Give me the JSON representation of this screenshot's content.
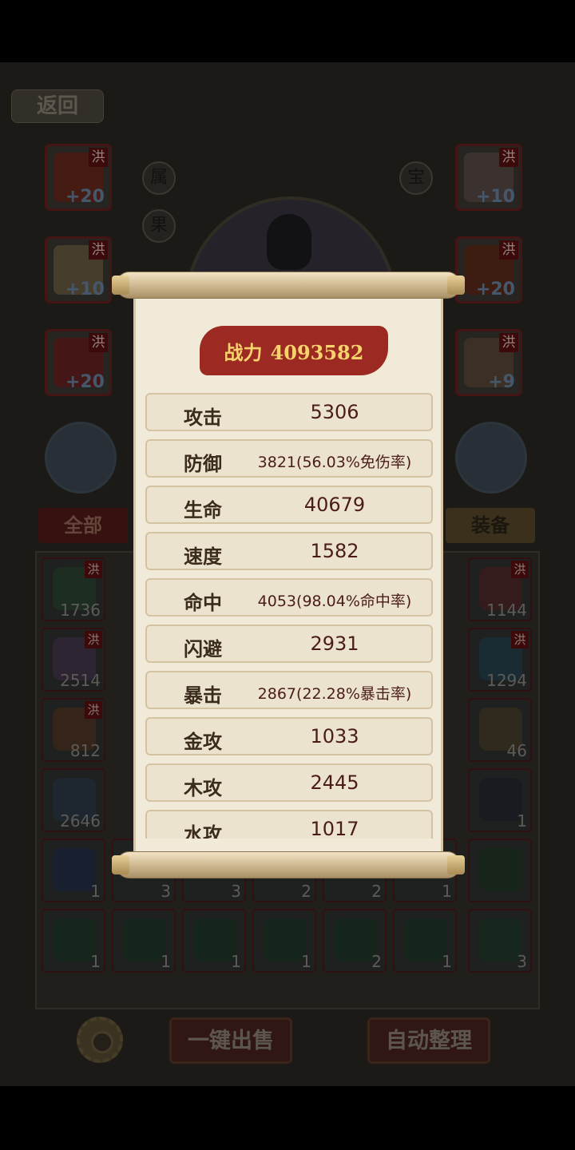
{
  "header": {
    "back_label": "返回"
  },
  "side_buttons": {
    "attr": "属",
    "fruit": "果",
    "treasure": "宝"
  },
  "equipment_left": [
    {
      "name": "weapon",
      "tag": "洪",
      "level": "+20",
      "color": "#6b2a1e"
    },
    {
      "name": "scroll",
      "tag": "洪",
      "level": "+10",
      "color": "#6c5f45"
    },
    {
      "name": "orb",
      "tag": "洪",
      "level": "+20",
      "color": "#6b2323"
    }
  ],
  "equipment_right": [
    {
      "name": "armor",
      "tag": "洪",
      "level": "+10",
      "color": "#5b4d4a"
    },
    {
      "name": "mount",
      "tag": "洪",
      "level": "+20",
      "color": "#5e2d1c"
    },
    {
      "name": "ring",
      "tag": "洪",
      "level": "+9",
      "color": "#5d4b3b"
    }
  ],
  "tabs": {
    "all": "全部",
    "equipment": "装备"
  },
  "inventory": {
    "col_left": [
      {
        "count": "1736",
        "tag": "洪",
        "color": "#2e4b34"
      },
      {
        "count": "2514",
        "tag": "洪",
        "color": "#4d3c55"
      },
      {
        "count": "812",
        "tag": "洪",
        "color": "#5a3a26"
      },
      {
        "count": "2646",
        "tag": "",
        "color": "#2e4050"
      },
      {
        "count": "1",
        "tag": "",
        "color": "#23304f"
      },
      {
        "count": "1",
        "tag": "",
        "color": "#1f3d2b"
      }
    ],
    "col_right": [
      {
        "count": "1144",
        "tag": "洪",
        "color": "#5a2a2a"
      },
      {
        "count": "1294",
        "tag": "洪",
        "color": "#25485a"
      },
      {
        "count": "46",
        "tag": "",
        "color": "#52432d"
      },
      {
        "count": "1",
        "tag": "",
        "color": "#232a36"
      },
      {
        "count": "",
        "tag": "",
        "color": "#1f3a27"
      },
      {
        "count": "3",
        "tag": "",
        "color": "#22402e"
      }
    ],
    "bottom_row": [
      {
        "count": "1",
        "color": "#203b2a"
      },
      {
        "count": "1",
        "color": "#203b2a"
      },
      {
        "count": "1",
        "color": "#203b2a"
      },
      {
        "count": "1",
        "color": "#203b2a"
      },
      {
        "count": "2",
        "color": "#203b2a"
      },
      {
        "count": "1",
        "color": "#203b2a"
      }
    ],
    "peek_row": [
      {
        "count": "3"
      },
      {
        "count": "3"
      },
      {
        "count": "2"
      },
      {
        "count": "2"
      },
      {
        "count": "1"
      }
    ]
  },
  "actions": {
    "sell_all": "一键出售",
    "auto_sort": "自动整理"
  },
  "popup": {
    "power_label": "战力",
    "power_value": "4093582",
    "stats": [
      {
        "name": "攻击",
        "value": "5306"
      },
      {
        "name": "防御",
        "value": "3821(56.03%免伤率)"
      },
      {
        "name": "生命",
        "value": "40679"
      },
      {
        "name": "速度",
        "value": "1582"
      },
      {
        "name": "命中",
        "value": "4053(98.04%命中率)"
      },
      {
        "name": "闪避",
        "value": "2931"
      },
      {
        "name": "暴击",
        "value": "2867(22.28%暴击率)"
      },
      {
        "name": "金攻",
        "value": "1033"
      },
      {
        "name": "木攻",
        "value": "2445"
      },
      {
        "name": "水攻",
        "value": "1017"
      }
    ]
  },
  "colors": {
    "banner_red": "#9c2a22",
    "gold_text": "#f7d26d",
    "paper": "#f2ead9"
  }
}
